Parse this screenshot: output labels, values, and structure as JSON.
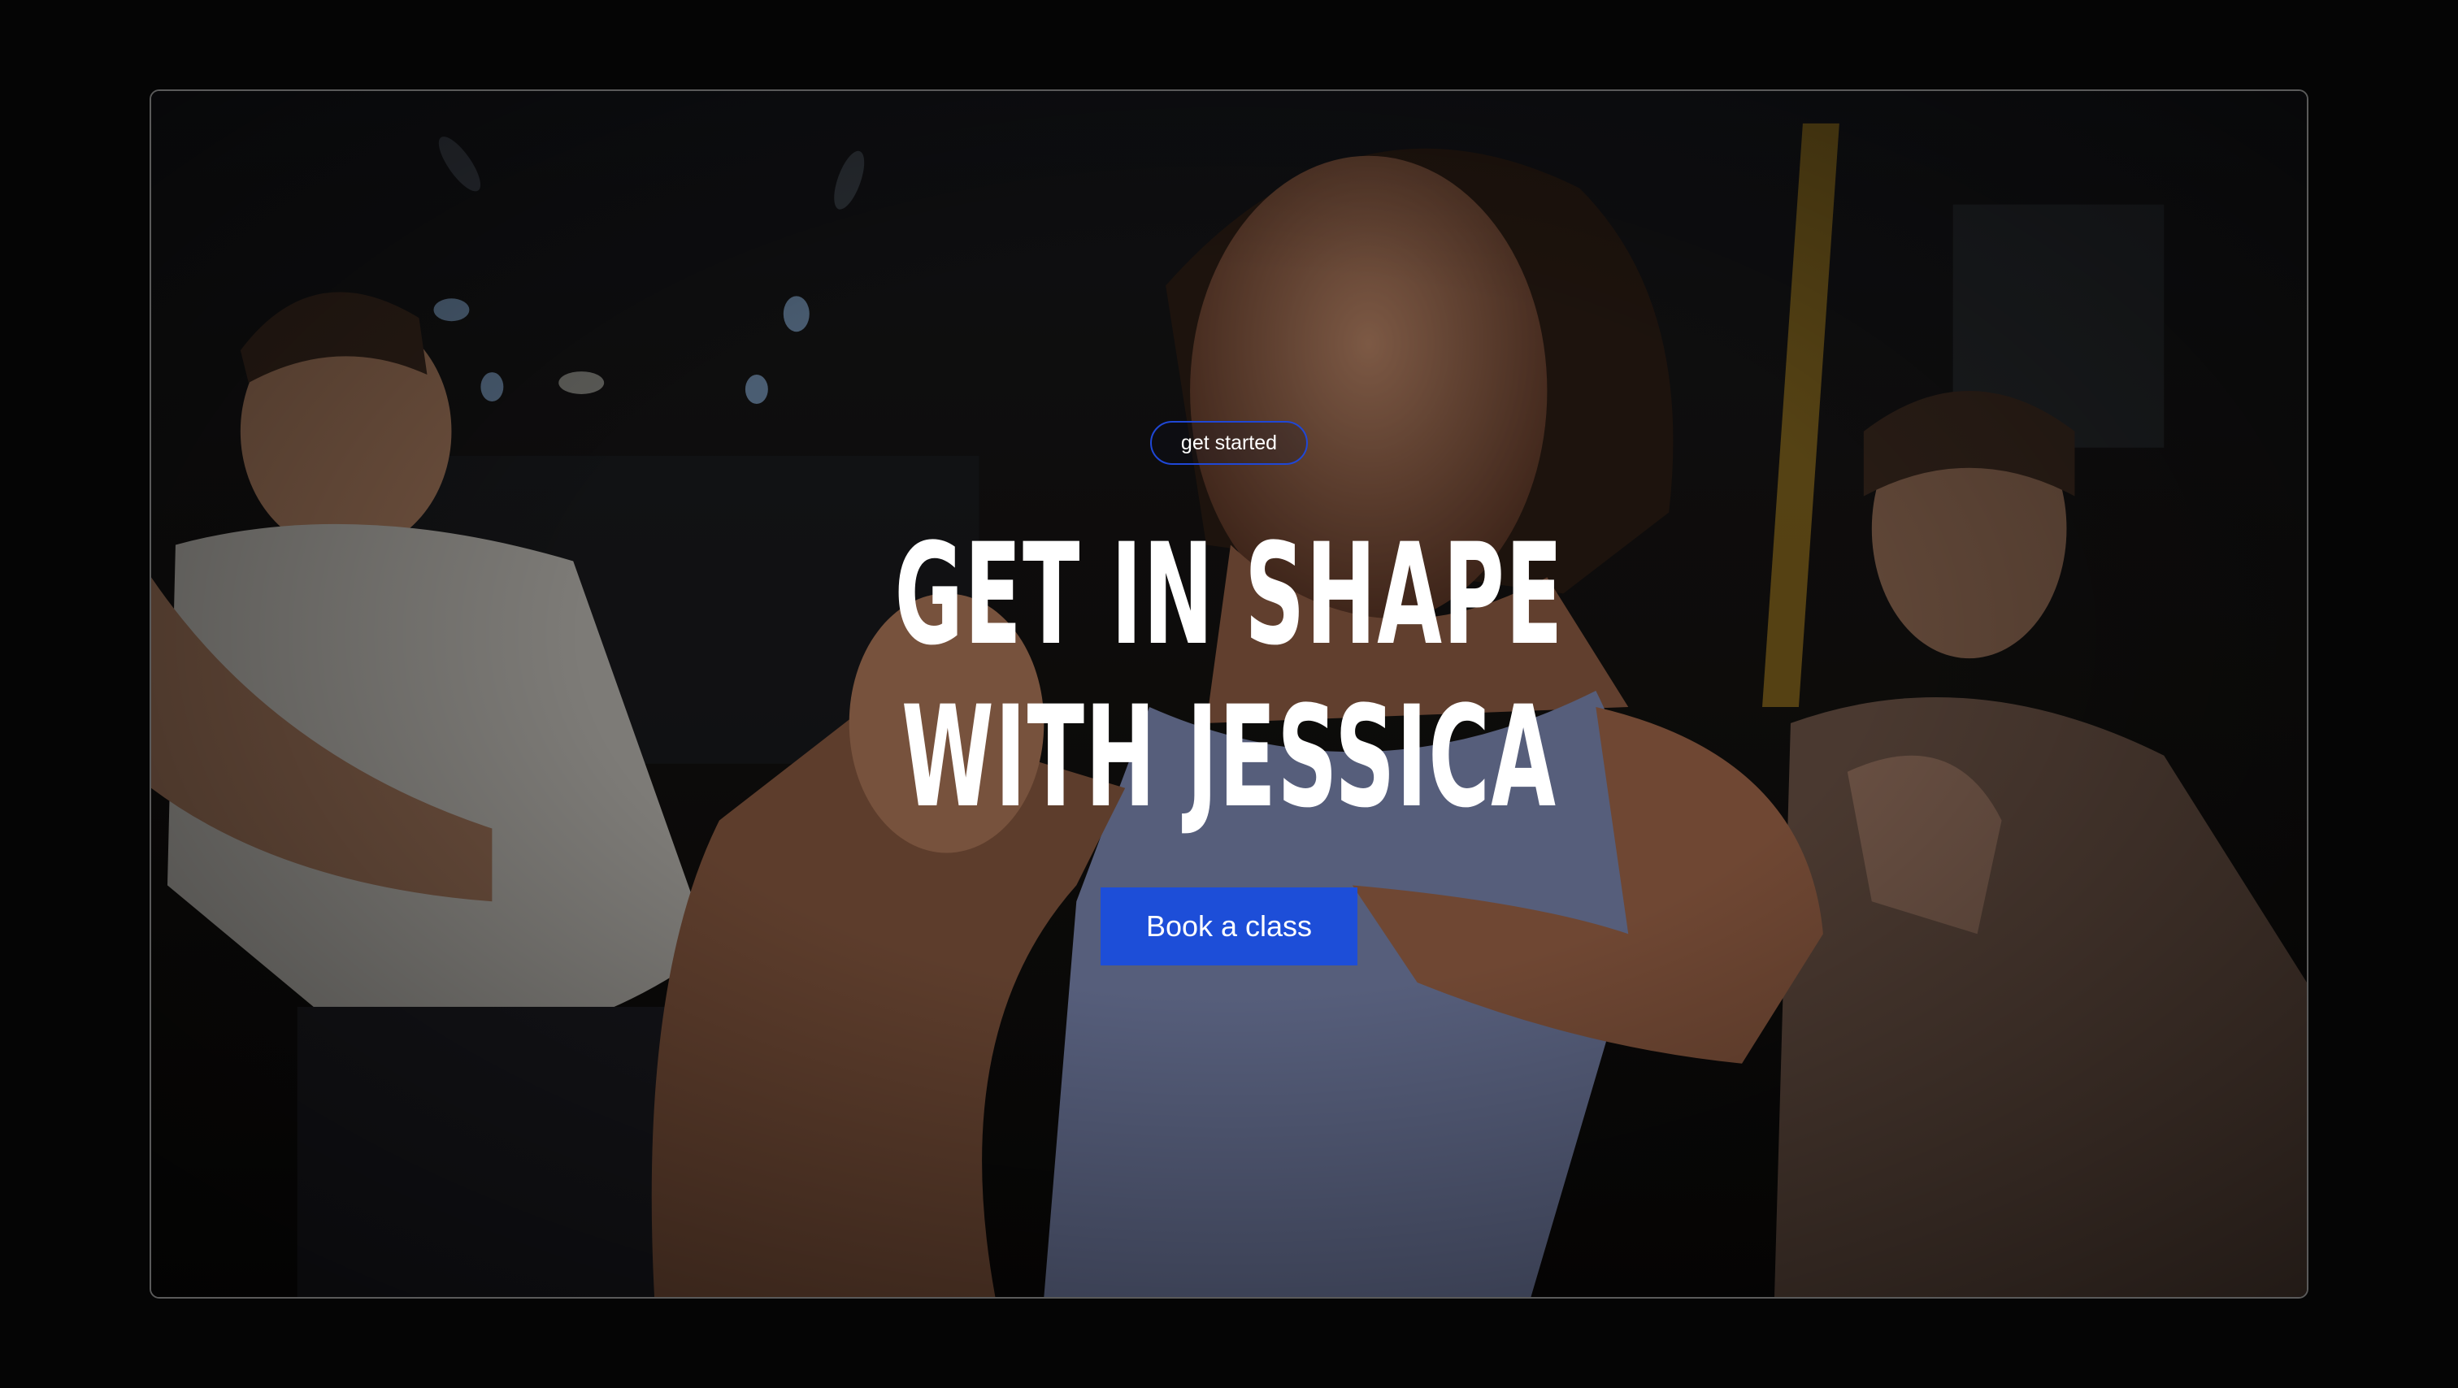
{
  "hero": {
    "badge_label": "get started",
    "headline_line1": "GET IN SHAPE",
    "headline_line2": "WITH JESSICA",
    "cta_label": "Book a class"
  },
  "colors": {
    "page_background": "#050505",
    "accent": "#1d4ed8",
    "badge_border": "#1f47d6",
    "text": "#ffffff"
  }
}
